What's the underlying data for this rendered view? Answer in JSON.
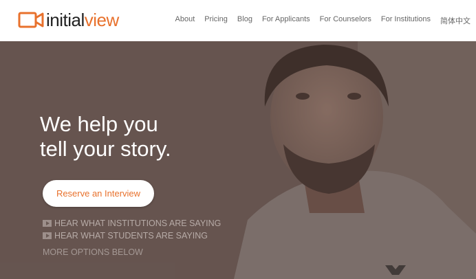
{
  "brand": {
    "name_part1": "initial",
    "name_part2": "view",
    "accent": "#e8712c"
  },
  "nav": {
    "items": [
      "About",
      "Pricing",
      "Blog",
      "For Applicants",
      "For Counselors",
      "For Institutions",
      "简体中文"
    ]
  },
  "hero": {
    "headline_line1": "We help you",
    "headline_line2": "tell your story.",
    "cta_label": "Reserve an Interview",
    "links": [
      "HEAR WHAT INSTITUTIONS ARE SAYING",
      "HEAR WHAT STUDENTS ARE SAYING"
    ],
    "more_label": "MORE OPTIONS BELOW"
  },
  "icons": {
    "logo": "video-camera-icon",
    "link": "play-icon"
  }
}
